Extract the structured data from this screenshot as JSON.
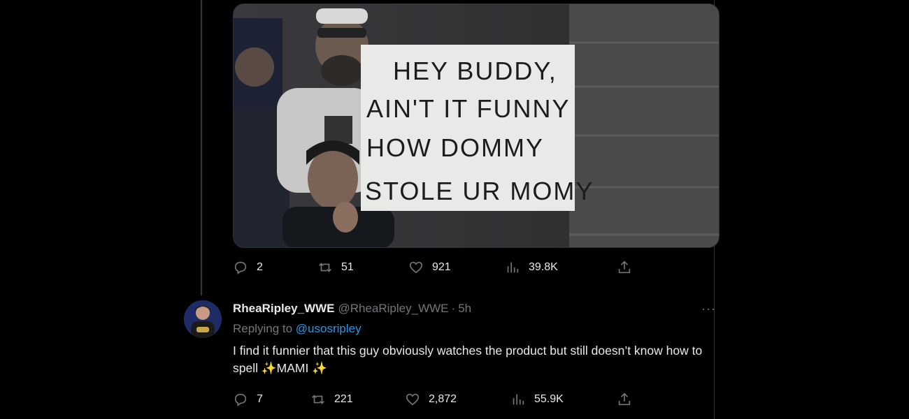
{
  "first_tweet": {
    "media": {
      "alt_description_icon": "sign-photo",
      "sign_lines": [
        "HEY BUDDY,",
        "AIN'T IT FUNNY",
        "HOW DOMMY",
        "STOLE UR MOMY"
      ]
    },
    "actions": {
      "replies": "2",
      "retweets": "51",
      "likes": "921",
      "views": "39.8K"
    }
  },
  "reply_tweet": {
    "display_name": "RheaRipley_WWE",
    "handle": "@RheaRipley_WWE",
    "separator": "·",
    "time": "5h",
    "more_label": "···",
    "replying_prefix": "Replying to",
    "replying_to": "@usosripley",
    "text_part1": "I find it funnier that this guy obviously watches the product but still doesn’t know how to spell ",
    "sparkle": "✨",
    "text_part2": "MAMI ",
    "actions": {
      "replies": "7",
      "retweets": "221",
      "likes": "2,872",
      "views": "55.9K"
    }
  },
  "colors": {
    "background": "#000000",
    "text": "#e7e9ea",
    "muted": "#71767b",
    "link": "#1d9bf0",
    "border": "#2f3336"
  }
}
